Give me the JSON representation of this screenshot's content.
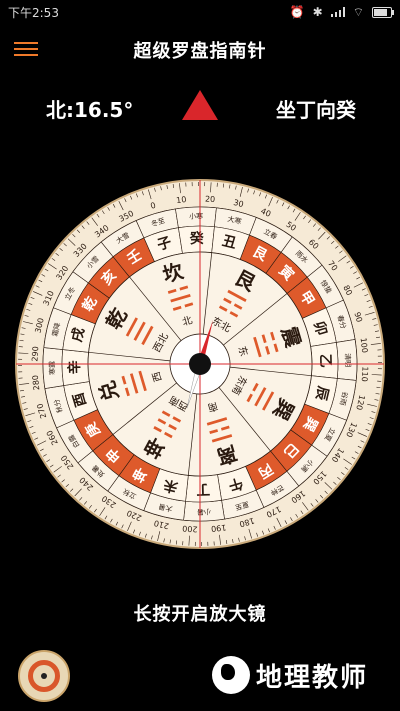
{
  "status": {
    "time": "下午2:53",
    "wifi_label": "⌔",
    "bluetooth_label": "✱",
    "alarm_label": "⏰"
  },
  "app": {
    "title": "超级罗盘指南针"
  },
  "reading": {
    "heading": "北:16.5°",
    "mountain": "坐丁向癸"
  },
  "compass": {
    "heading_deg": 16.5,
    "degree_labels": [
      "0",
      "10",
      "20",
      "30",
      "40",
      "50",
      "60",
      "70",
      "80",
      "90",
      "100",
      "110",
      "120",
      "130",
      "140",
      "150",
      "160",
      "170",
      "180",
      "190",
      "200",
      "210",
      "220",
      "230",
      "240",
      "250",
      "260",
      "270",
      "280",
      "290",
      "300",
      "310",
      "320",
      "330",
      "340",
      "350"
    ],
    "mountains": [
      "子",
      "癸",
      "丑",
      "艮",
      "寅",
      "甲",
      "卯",
      "乙",
      "辰",
      "巽",
      "巳",
      "丙",
      "午",
      "丁",
      "未",
      "坤",
      "申",
      "庚",
      "酉",
      "辛",
      "戌",
      "乾",
      "亥",
      "壬"
    ],
    "trigram_names": [
      "坎",
      "艮",
      "震",
      "巽",
      "离",
      "坤",
      "兑",
      "乾"
    ],
    "trigram_symbols": [
      "☵",
      "☶",
      "☳",
      "☴",
      "☲",
      "☷",
      "☱",
      "☰"
    ],
    "directions": [
      "北",
      "东北",
      "东",
      "东南",
      "南",
      "西南",
      "西",
      "西北"
    ],
    "red_mountains": [
      "艮",
      "寅",
      "甲",
      "巽",
      "巳",
      "丙",
      "坤",
      "申",
      "庚",
      "乾",
      "亥",
      "壬"
    ],
    "solar_terms": [
      "冬至",
      "小寒",
      "大寒",
      "立春",
      "雨水",
      "惊蛰",
      "春分",
      "清明",
      "谷雨",
      "立夏",
      "小满",
      "芒种",
      "夏至",
      "小暑",
      "大暑",
      "立秋",
      "处暑",
      "白露",
      "秋分",
      "寒露",
      "霜降",
      "立冬",
      "小雪",
      "大雪"
    ],
    "colors": {
      "rim": "#f6ead6",
      "accent": "#de5a2b",
      "ink": "#2a1a10",
      "needle": "#d9262b",
      "hub": "#111111"
    }
  },
  "hint": "长按开启放大镜",
  "watermark": "地理教师"
}
